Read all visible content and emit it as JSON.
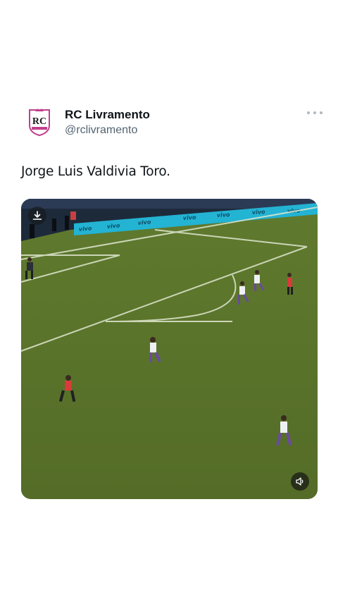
{
  "account": {
    "display_name": "RC Livramento",
    "handle": "@rclivramento",
    "avatar_text": "RC",
    "avatar_icon": "club-crest"
  },
  "menu_icon": "more-horizontal-icon",
  "tweet": {
    "text": "Jorge Luis Valdivia Toro."
  },
  "video": {
    "ad_board_text": [
      "vivo",
      "vivo",
      "vivo",
      "vivo",
      "vivo",
      "vivo",
      "vivo"
    ],
    "download_icon": "download-icon",
    "sound_icon": "speaker-icon"
  },
  "colors": {
    "pitch": "#5f7a2e",
    "ad_board": "#23b3d3",
    "home_kit": "#d93a3a",
    "away_kit": "#eef0f4"
  }
}
